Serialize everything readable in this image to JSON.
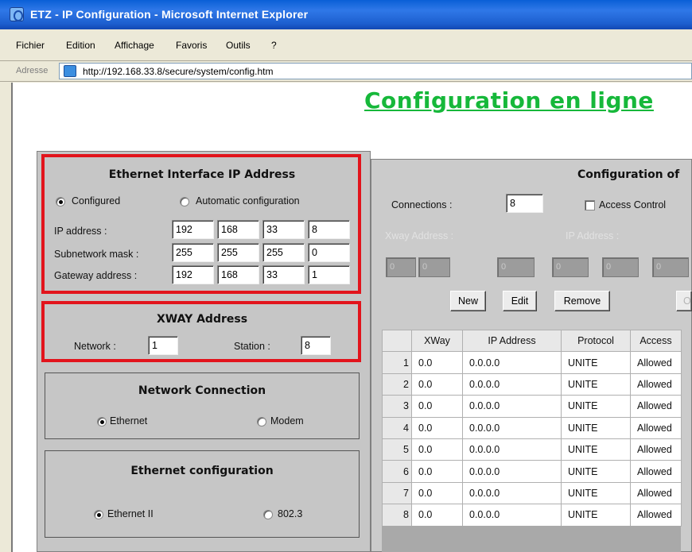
{
  "window": {
    "title": "ETZ - IP Configuration - Microsoft Internet Explorer"
  },
  "menu": [
    "Fichier",
    "Edition",
    "Affichage",
    "Favoris",
    "Outils",
    "?"
  ],
  "address_bar": {
    "label": "Adresse",
    "url": "http://192.168.33.8/secure/system/config.htm"
  },
  "page": {
    "heading": "Configuration en ligne"
  },
  "ethernet_ip": {
    "title": "Ethernet Interface IP Address",
    "mode_configured": "Configured",
    "mode_automatic": "Automatic configuration",
    "selected_mode": "Configured",
    "rows": [
      {
        "label": "IP address :",
        "values": [
          "192",
          "168",
          "33",
          "8"
        ]
      },
      {
        "label": "Subnetwork mask :",
        "values": [
          "255",
          "255",
          "255",
          "0"
        ]
      },
      {
        "label": "Gateway address :",
        "values": [
          "192",
          "168",
          "33",
          "1"
        ]
      }
    ]
  },
  "xway": {
    "title": "XWAY Address",
    "network_label": "Network :",
    "network_value": "1",
    "station_label": "Station :",
    "station_value": "8"
  },
  "network_connection": {
    "title": "Network Connection",
    "option_ethernet": "Ethernet",
    "option_modem": "Modem",
    "selected": "Ethernet"
  },
  "ethernet_config": {
    "title": "Ethernet configuration",
    "option_ethernet2": "Ethernet II",
    "option_8023": "802.3",
    "selected": "Ethernet II"
  },
  "access_config": {
    "title": "Configuration of",
    "connections_label": "Connections :",
    "connections_value": "8",
    "access_control_label": "Access Control",
    "access_control_checked": false,
    "xway_address_label": "Xway Address :",
    "ip_address_label": "IP Address :",
    "disabled_field_value": "0",
    "buttons": {
      "new": "New",
      "edit": "Edit",
      "remove": "Remove",
      "cut": "O"
    },
    "table": {
      "columns": [
        "",
        "XWay",
        "IP Address",
        "Protocol",
        "Access"
      ],
      "rows": [
        [
          "1",
          "0.0",
          "0.0.0.0",
          "UNITE",
          "Allowed"
        ],
        [
          "2",
          "0.0",
          "0.0.0.0",
          "UNITE",
          "Allowed"
        ],
        [
          "3",
          "0.0",
          "0.0.0.0",
          "UNITE",
          "Allowed"
        ],
        [
          "4",
          "0.0",
          "0.0.0.0",
          "UNITE",
          "Allowed"
        ],
        [
          "5",
          "0.0",
          "0.0.0.0",
          "UNITE",
          "Allowed"
        ],
        [
          "6",
          "0.0",
          "0.0.0.0",
          "UNITE",
          "Allowed"
        ],
        [
          "7",
          "0.0",
          "0.0.0.0",
          "UNITE",
          "Allowed"
        ],
        [
          "8",
          "0.0",
          "0.0.0.0",
          "UNITE",
          "Allowed"
        ]
      ]
    }
  },
  "colors": {
    "heading": "#16b83a",
    "highlight": "#e2141c",
    "titlebar": "#1d5fcf",
    "panel": "#c6c6c6"
  }
}
